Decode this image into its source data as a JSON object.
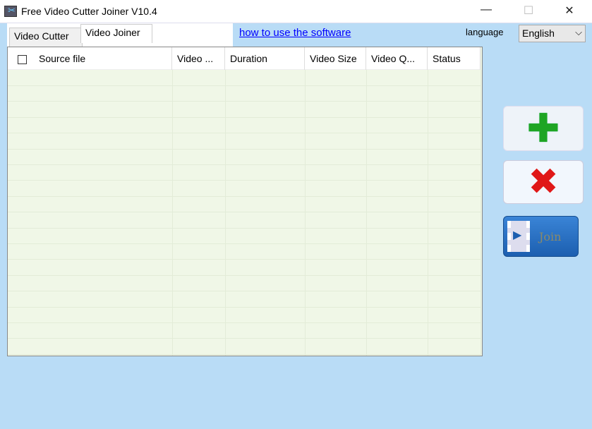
{
  "window": {
    "title": "Free Video Cutter Joiner V10.4",
    "minimize": "—",
    "maximize": "☐",
    "close": "✕"
  },
  "tabs": [
    {
      "label": "Video Cutter"
    },
    {
      "label": "Video Joiner"
    }
  ],
  "help_link": "how to use the software",
  "language": {
    "label": "language",
    "selected": "English",
    "chevron": "⌵"
  },
  "table": {
    "columns": [
      "Source file",
      "Video ...",
      "Duration",
      "Video Size",
      "Video Q...",
      "Status"
    ],
    "rows": []
  },
  "buttons": {
    "add_glyph": "✚",
    "remove_glyph": "✖",
    "join_label": "Join"
  }
}
